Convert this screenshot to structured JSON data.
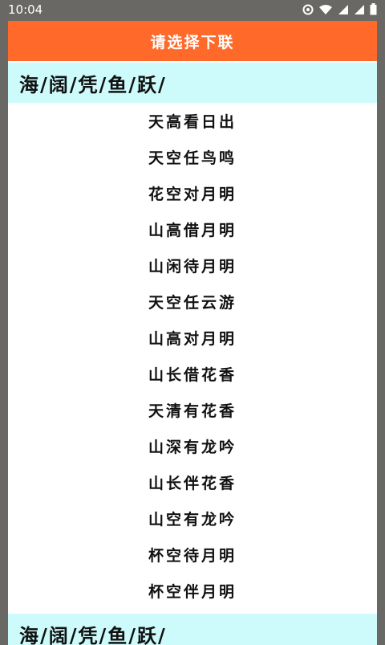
{
  "status_bar": {
    "time": "10:04",
    "icons": [
      "sync-icon",
      "wifi-icon",
      "signal-icon",
      "signal-icon",
      "battery-icon"
    ]
  },
  "dialog": {
    "title": "请选择下联",
    "upper_line": "海/阔/凭/鱼/跃/",
    "options": [
      "天高看日出",
      "天空任鸟鸣",
      "花空对月明",
      "山高借月明",
      "山闲待月明",
      "天空任云游",
      "山高对月明",
      "山长借花香",
      "天清有花香",
      "山深有龙吟",
      "山长伴花香",
      "山空有龙吟",
      "杯空待月明",
      "杯空伴月明"
    ],
    "upper_line_repeat": "海/阔/凭/鱼/跃/"
  },
  "colors": {
    "header_bg": "#ff6a2b",
    "upper_line_bg": "#cdfafb",
    "backdrop": "#6a6864"
  }
}
